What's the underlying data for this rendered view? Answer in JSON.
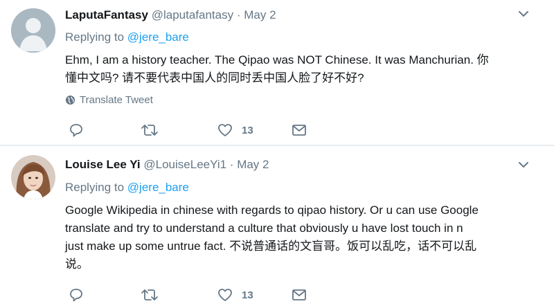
{
  "tweets": [
    {
      "name": "LaputaFantasy",
      "handle": "@laputafantasy",
      "separator": "·",
      "date": "May 2",
      "replying_prefix": "Replying to",
      "replying_to": "@jere_bare",
      "text_line1": "Ehm, I am a history teacher. The Qipao was NOT Chinese. It was Manchurian. 你",
      "text_line2": "懂中文吗? 请不要代表中国人的同时丢中国人脸了好不好?",
      "translate_label": "Translate Tweet",
      "like_count": "13"
    },
    {
      "name": "Louise Lee Yi",
      "handle": "@LouiseLeeYi1",
      "separator": "·",
      "date": "May 2",
      "replying_prefix": "Replying to",
      "replying_to": "@jere_bare",
      "text_line1": "Google Wikipedia in chinese with regards to qipao history. Or u can use Google",
      "text_line2": "translate and try to understand a culture that obviously u have lost touch in n",
      "text_line3": "just make up some untrue fact. 不说普通话的文盲哥。饭可以乱吃，话不可以乱",
      "text_line4": "说。",
      "like_count": "13"
    }
  ],
  "icons": {
    "reply": "reply-icon",
    "retweet": "retweet-icon",
    "like": "heart-icon",
    "message": "mail-icon",
    "more": "chevron-down-icon",
    "globe": "globe-icon"
  },
  "colors": {
    "text": "#14171a",
    "secondary": "#657786",
    "link": "#1da1f2",
    "divider": "#e6ecf0"
  }
}
